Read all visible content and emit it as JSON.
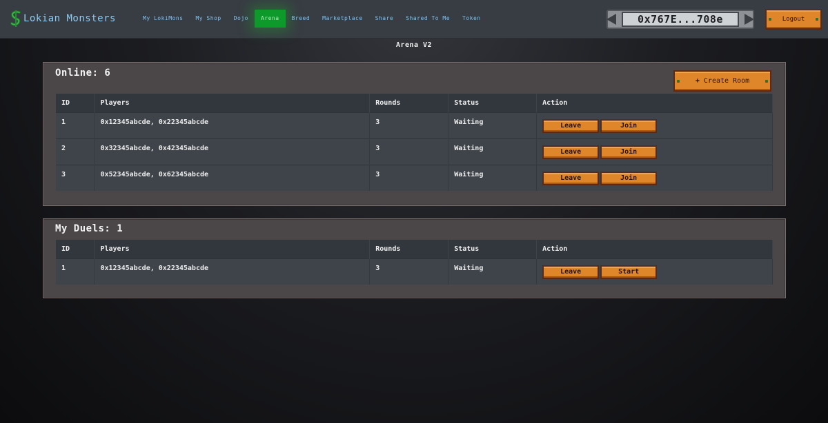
{
  "app": {
    "brand": "Lokian Monsters",
    "colors": {
      "brand_text": "#8ecbf0",
      "nav_active": "#0d9a2a",
      "wood": "#e0862a",
      "panel": "#4b4749"
    }
  },
  "nav": {
    "items": [
      {
        "label": "My LokiMons",
        "active": false
      },
      {
        "label": "My Shop",
        "active": false
      },
      {
        "label": "Dojo",
        "active": false
      },
      {
        "label": "Arena",
        "active": true
      },
      {
        "label": "Breed",
        "active": false
      },
      {
        "label": "Marketplace",
        "active": false
      },
      {
        "label": "Share",
        "active": false
      },
      {
        "label": "Shared To Me",
        "active": false
      },
      {
        "label": "Token",
        "active": false
      }
    ],
    "wallet": "0x767E...708e",
    "logout_label": "Logout"
  },
  "page": {
    "title": "Arena V2"
  },
  "online": {
    "heading": "Online: 6",
    "create_label": "Create Room",
    "create_icon": "plus-icon",
    "columns": [
      "ID",
      "Players",
      "Rounds",
      "Status",
      "Action"
    ],
    "rows": [
      {
        "id": "1",
        "players": "0x12345abcde, 0x22345abcde",
        "rounds": "3",
        "status": "Waiting",
        "actions": [
          "Leave",
          "Join"
        ]
      },
      {
        "id": "2",
        "players": "0x32345abcde, 0x42345abcde",
        "rounds": "3",
        "status": "Waiting",
        "actions": [
          "Leave",
          "Join"
        ]
      },
      {
        "id": "3",
        "players": "0x52345abcde, 0x62345abcde",
        "rounds": "3",
        "status": "Waiting",
        "actions": [
          "Leave",
          "Join"
        ]
      }
    ]
  },
  "duels": {
    "heading": "My Duels: 1",
    "columns": [
      "ID",
      "Players",
      "Rounds",
      "Status",
      "Action"
    ],
    "rows": [
      {
        "id": "1",
        "players": "0x12345abcde, 0x22345abcde",
        "rounds": "3",
        "status": "Waiting",
        "actions": [
          "Leave",
          "Start"
        ]
      }
    ]
  }
}
